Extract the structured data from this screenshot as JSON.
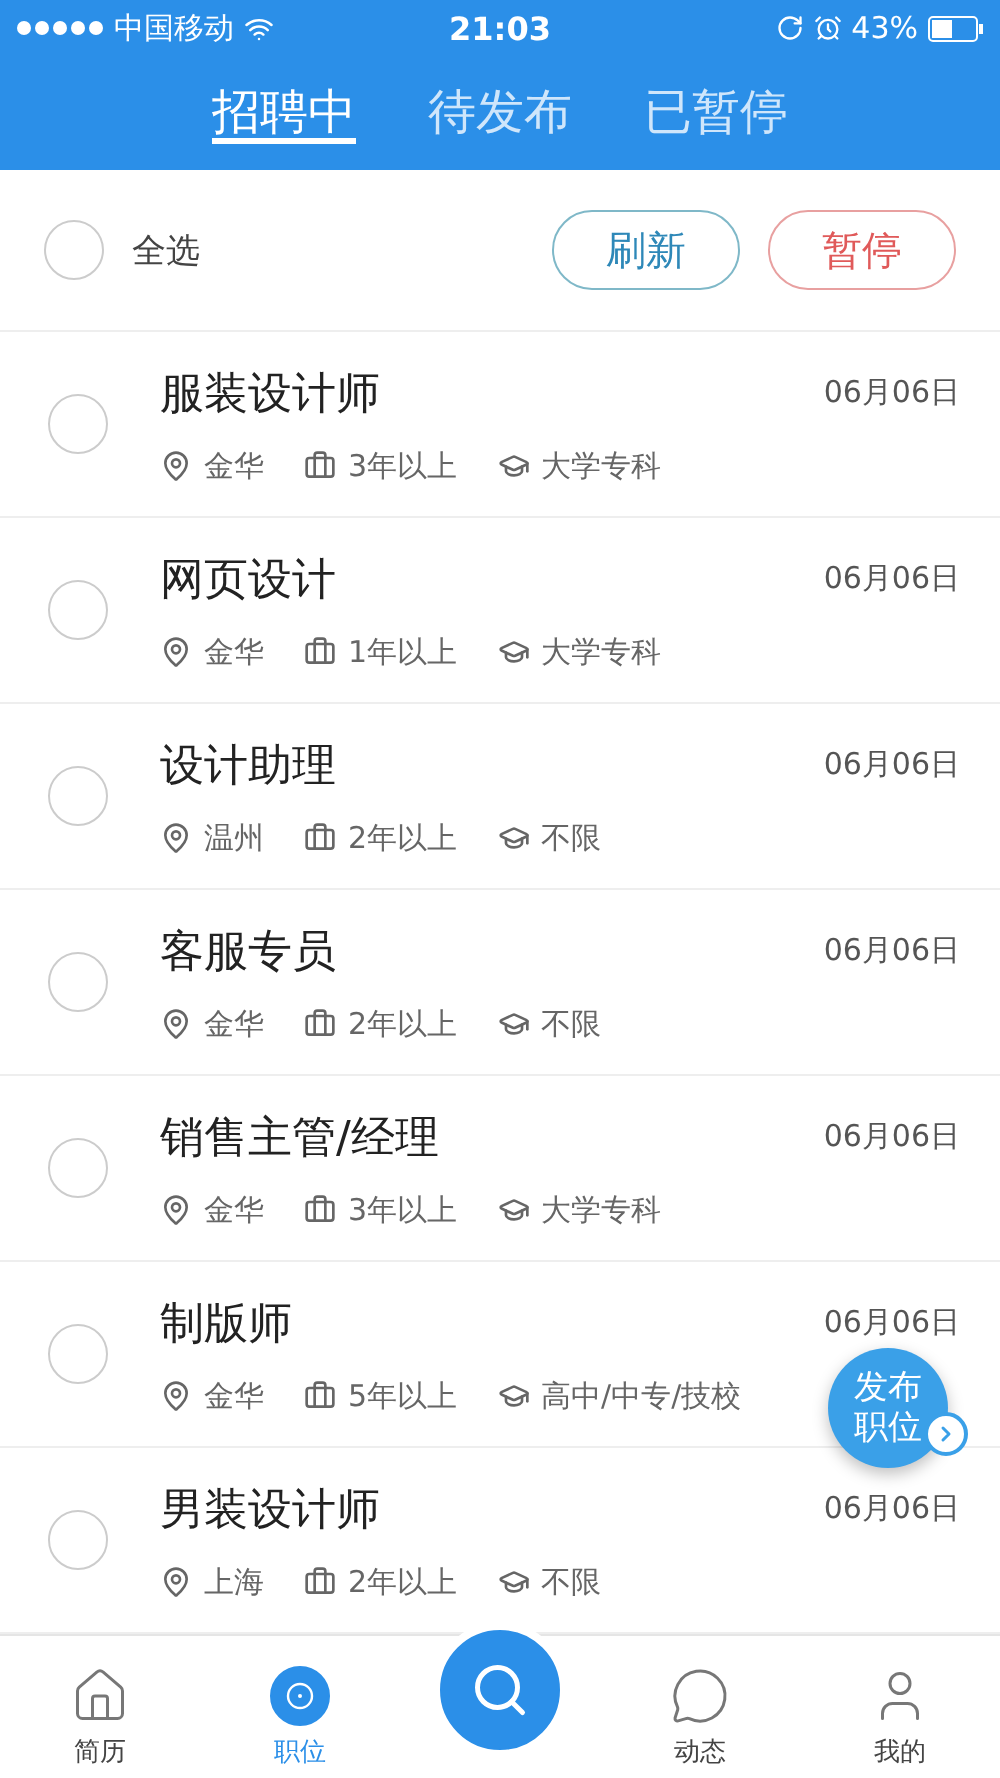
{
  "status_bar": {
    "carrier": "中国移动",
    "time": "21:03",
    "battery": "43%"
  },
  "tabs": [
    {
      "label": "招聘中",
      "selected": true
    },
    {
      "label": "待发布",
      "selected": false
    },
    {
      "label": "已暂停",
      "selected": false
    }
  ],
  "toolbar": {
    "select_all": {
      "label": "全选",
      "checked": false
    },
    "buttons": [
      {
        "label": "刷新",
        "kind": "primary"
      },
      {
        "label": "暂停",
        "kind": "danger"
      }
    ]
  },
  "jobs": [
    {
      "title": "服装设计师",
      "date": "06月06日",
      "city": "金华",
      "experience": "3年以上",
      "education": "大学专科",
      "checked": false
    },
    {
      "title": "网页设计",
      "date": "06月06日",
      "city": "金华",
      "experience": "1年以上",
      "education": "大学专科",
      "checked": false
    },
    {
      "title": "设计助理",
      "date": "06月06日",
      "city": "温州",
      "experience": "2年以上",
      "education": "不限",
      "checked": false
    },
    {
      "title": "客服专员",
      "date": "06月06日",
      "city": "金华",
      "experience": "2年以上",
      "education": "不限",
      "checked": false
    },
    {
      "title": "销售主管/经理",
      "date": "06月06日",
      "city": "金华",
      "experience": "3年以上",
      "education": "大学专科",
      "checked": false
    },
    {
      "title": "制版师",
      "date": "06月06日",
      "city": "金华",
      "experience": "5年以上",
      "education": "高中/中专/技校",
      "checked": false
    },
    {
      "title": "男装设计师",
      "date": "06月06日",
      "city": "上海",
      "experience": "2年以上",
      "education": "不限",
      "checked": false
    }
  ],
  "float_button": {
    "label": "发布职位"
  },
  "nav": [
    {
      "label": "简历",
      "kind": "home",
      "selected": false
    },
    {
      "label": "职位",
      "kind": "jobs",
      "selected": true
    },
    {
      "kind": "search"
    },
    {
      "label": "动态",
      "kind": "feed",
      "selected": false
    },
    {
      "label": "我的",
      "kind": "me",
      "selected": false
    }
  ]
}
